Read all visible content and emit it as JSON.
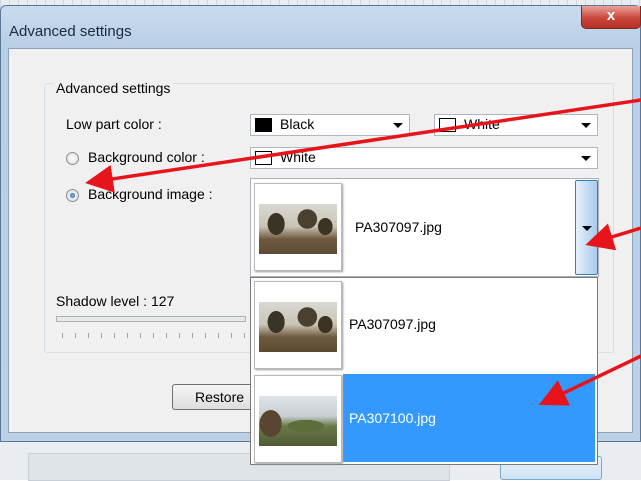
{
  "window": {
    "title": "Advanced settings",
    "close_glyph": "x"
  },
  "group": {
    "legend": "Advanced settings"
  },
  "low_part_color": {
    "label": "Low part color :",
    "primary": {
      "value": "Black",
      "swatch": "#000000"
    },
    "secondary": {
      "value": "White",
      "swatch": "#ffffff"
    }
  },
  "background_color": {
    "label": "Background color :",
    "selected": false,
    "value": "White",
    "swatch": "#ffffff"
  },
  "background_image": {
    "label": "Background image :",
    "selected": true,
    "current": "PA307097.jpg",
    "options": [
      {
        "name": "PA307097.jpg",
        "highlighted": false
      },
      {
        "name": "PA307100.jpg",
        "highlighted": true
      }
    ]
  },
  "shadow": {
    "label": "Shadow level : 127",
    "level": 127
  },
  "buttons": {
    "restore": "Restore"
  },
  "colors": {
    "highlight": "#3399ff",
    "annotation_arrow": "#e8141b"
  },
  "icons": [
    "close-icon",
    "chevron-down-icon",
    "radio-icon",
    "annotation-arrow-icon"
  ]
}
